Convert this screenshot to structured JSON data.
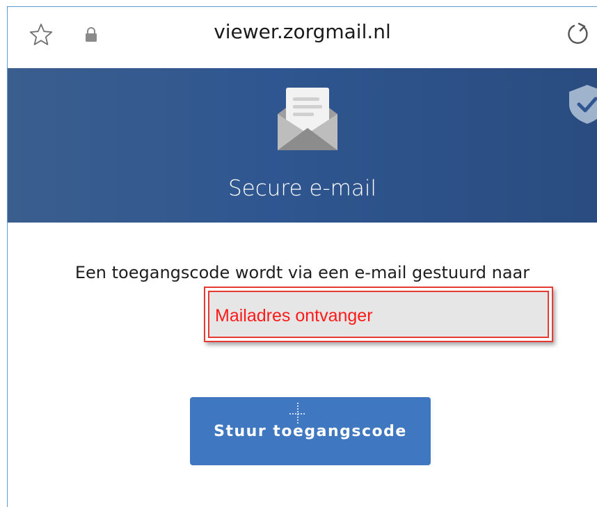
{
  "browser": {
    "url": "viewer.zorgmail.nl",
    "icons": {
      "favorite": "star-outline-icon",
      "secure": "lock-icon",
      "reload": "reload-icon"
    }
  },
  "banner": {
    "title": "Secure e-mail",
    "background_color": "#2f5690",
    "icons": {
      "main": "open-envelope-icon",
      "badge": "shield-check-icon"
    }
  },
  "form": {
    "info_text": "Een toegangscode wordt via een e-mail gestuurd naar",
    "recipient_field": "Mailadres ontvanger",
    "annotation_color": "#e53935",
    "send_button_label": "Stuur toegangscode",
    "button_color": "#3f77c0"
  }
}
